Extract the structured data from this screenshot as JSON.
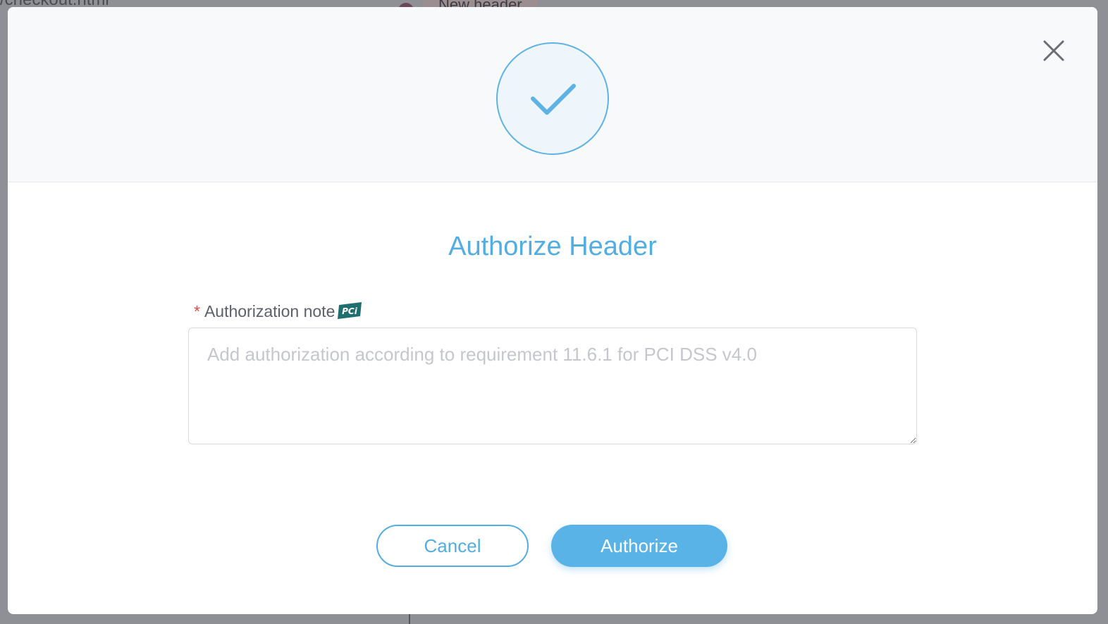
{
  "background": {
    "url_fragment": "/checkout.html",
    "tag_label": "New header"
  },
  "modal": {
    "title": "Authorize Header",
    "close_icon": "close-icon",
    "status_icon": "check-circle-icon",
    "field": {
      "required_marker": "*",
      "label": "Authorization note",
      "badge_icon": "pci-badge-icon",
      "placeholder": "Add authorization according to requirement 11.6.1 for PCI DSS v4.0",
      "value": ""
    },
    "buttons": {
      "cancel": "Cancel",
      "authorize": "Authorize"
    }
  },
  "colors": {
    "accent": "#52ade2",
    "primary_button": "#5ab3e6",
    "required": "#e04b4b",
    "header_bg": "#f8f9fb"
  }
}
